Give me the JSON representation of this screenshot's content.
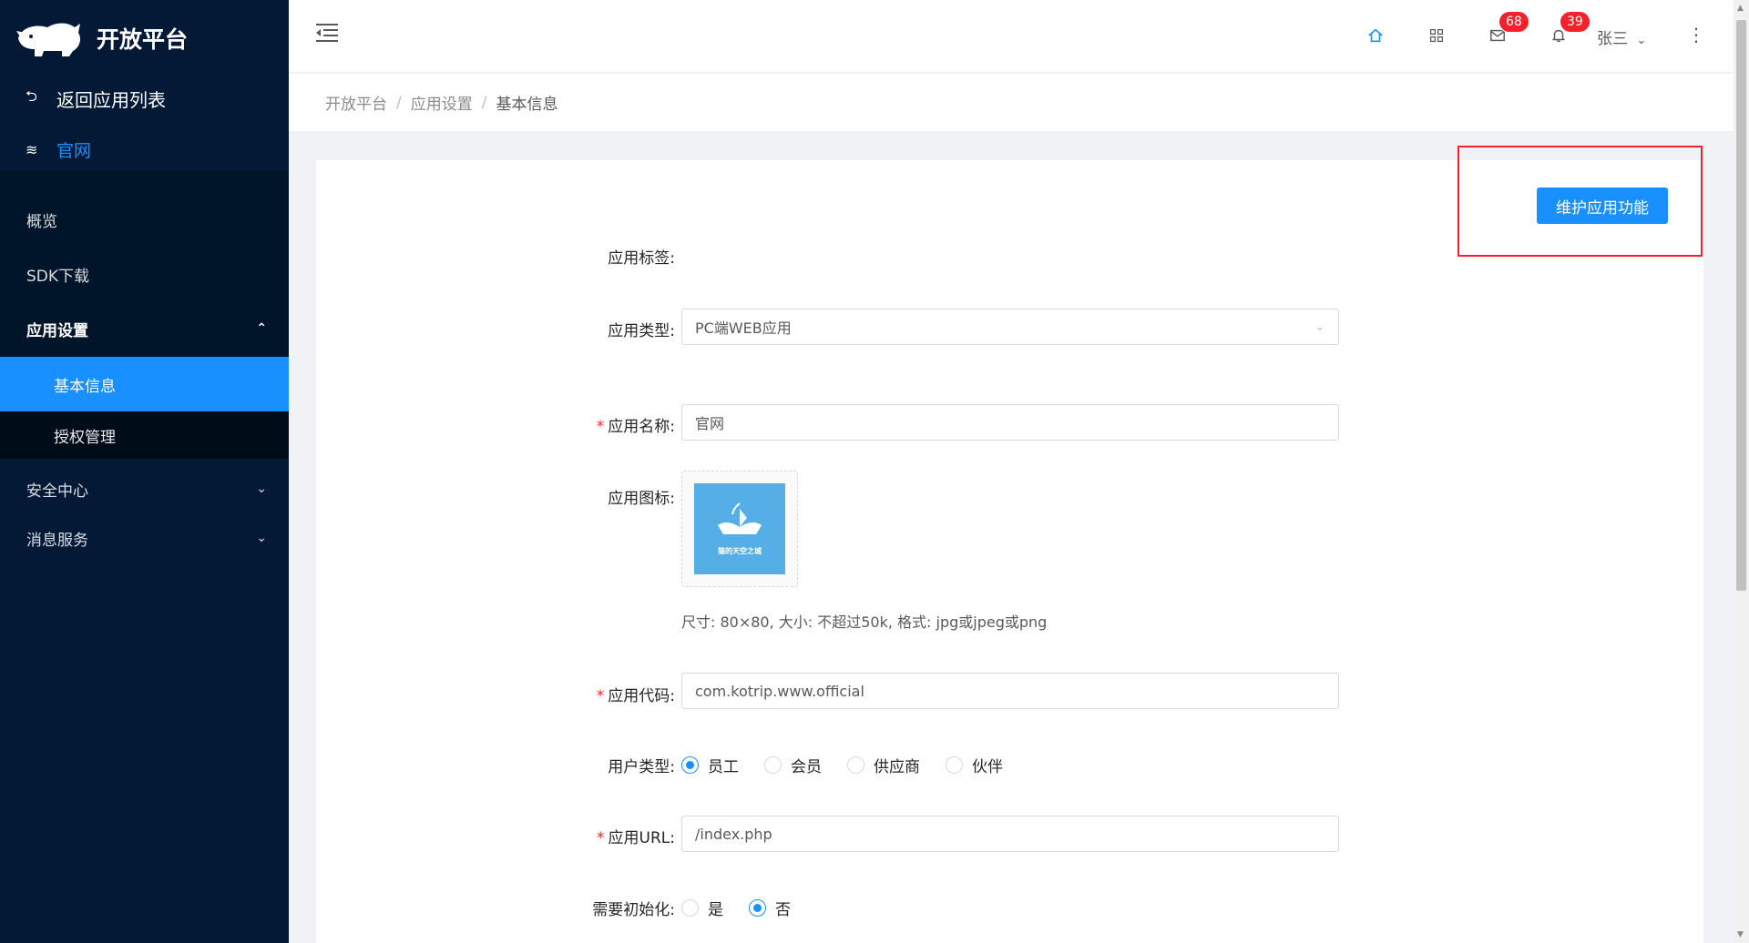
{
  "sidebar": {
    "logo_text": "开放平台",
    "back_label": "返回应用列表",
    "app_name": "官网",
    "menu": [
      {
        "label": "概览"
      },
      {
        "label": "SDK下载"
      },
      {
        "label": "应用设置"
      }
    ],
    "submenu": [
      {
        "label": "基本信息"
      },
      {
        "label": "授权管理"
      }
    ],
    "lower": [
      {
        "label": "安全中心"
      },
      {
        "label": "消息服务"
      }
    ]
  },
  "header": {
    "mail_badge": "68",
    "bell_badge": "39",
    "user": "张三"
  },
  "breadcrumb": [
    "开放平台",
    "应用设置",
    "基本信息"
  ],
  "actions": {
    "maintain_label": "维护应用功能"
  },
  "form": {
    "tag_label": "应用标签:",
    "type_label": "应用类型:",
    "type_value": "PC端WEB应用",
    "name_label": "应用名称:",
    "name_value": "官网",
    "icon_label": "应用图标:",
    "icon_caption": "猫的天空之城",
    "icon_hint": "尺寸: 80×80, 大小: 不超过50k, 格式: jpg或jpeg或png",
    "code_label": "应用代码:",
    "code_value": "com.kotrip.www.official",
    "user_type_label": "用户类型:",
    "user_types": [
      "员工",
      "会员",
      "供应商",
      "伙伴"
    ],
    "user_type_selected": "员工",
    "url_label": "应用URL:",
    "url_value": "/index.php",
    "init_label": "需要初始化:",
    "init_options": [
      "是",
      "否"
    ],
    "init_selected": "否",
    "required_mark": "*"
  }
}
